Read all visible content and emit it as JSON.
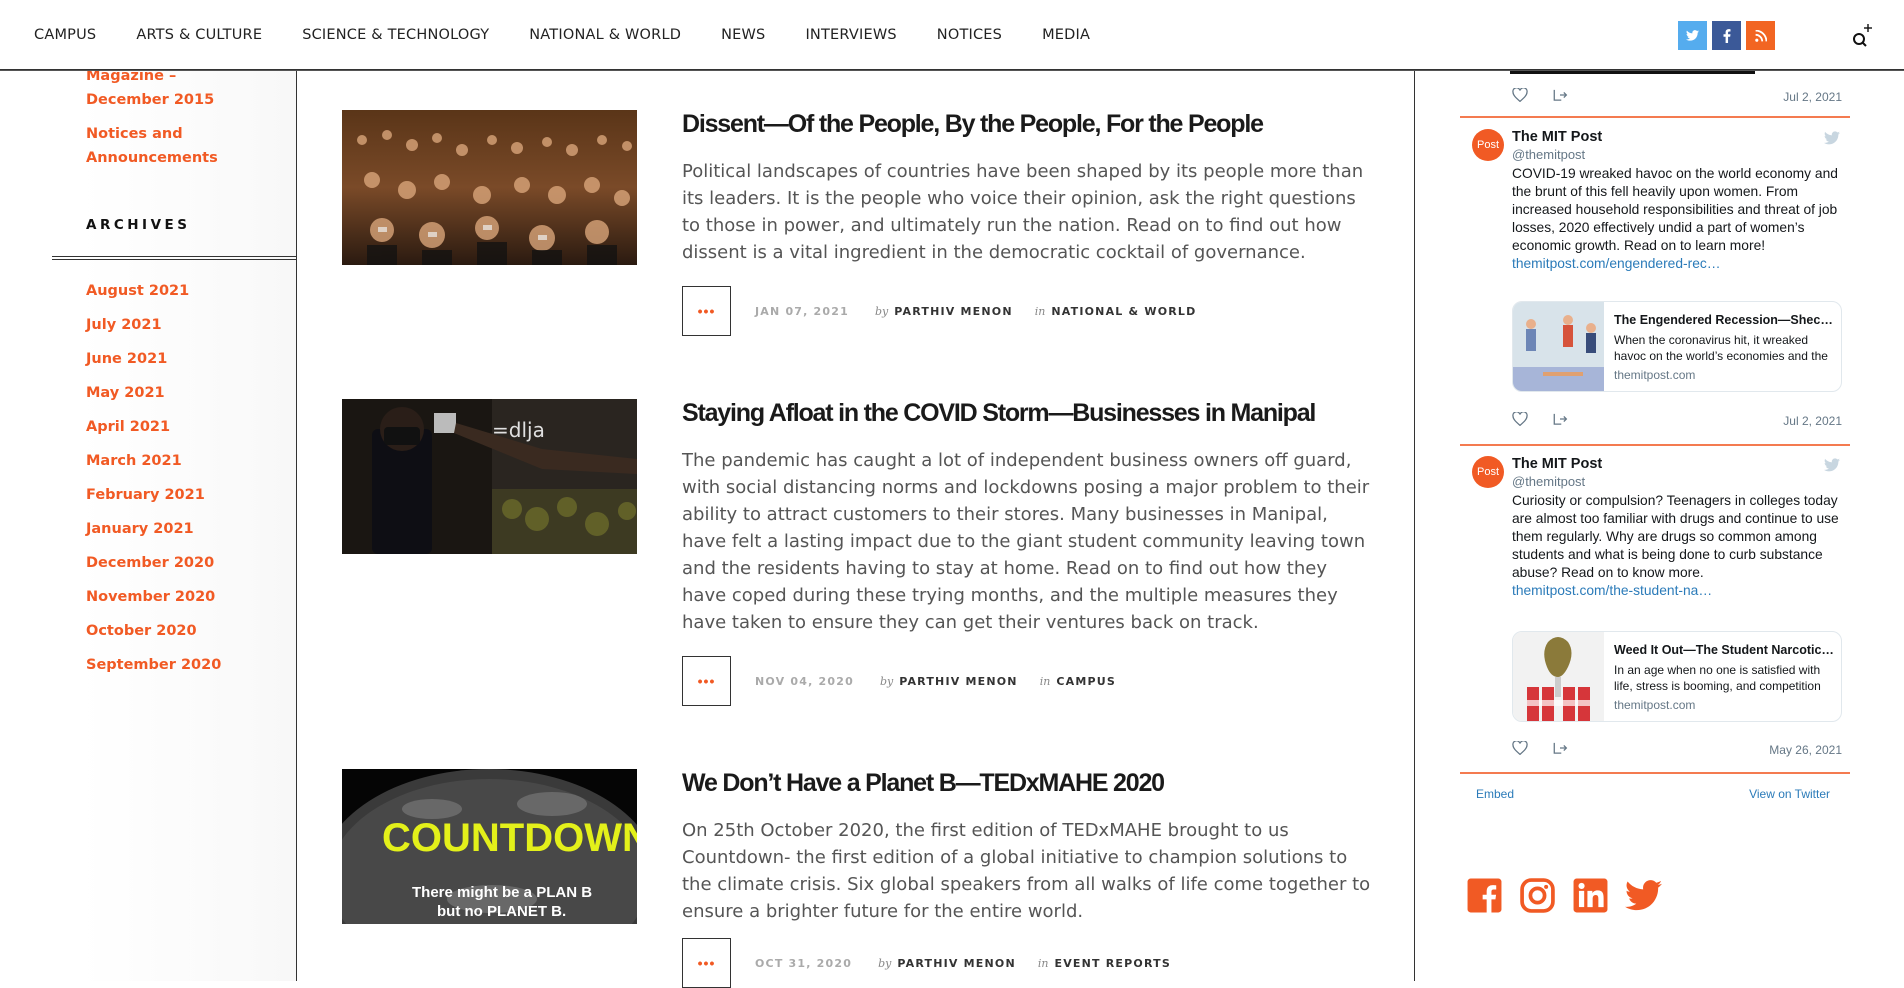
{
  "nav": {
    "items": [
      "CAMPUS",
      "ARTS & CULTURE",
      "SCIENCE & TECHNOLOGY",
      "NATIONAL & WORLD",
      "NEWS",
      "INTERVIEWS",
      "NOTICES",
      "MEDIA"
    ],
    "social": {
      "twitter": "t",
      "facebook": "f",
      "rss": "rss"
    },
    "search_icon": "search-icon"
  },
  "left_sidebar": {
    "link_magazine": "Magazine – December 2015",
    "link_notices": "Notices and Announcements",
    "archives_heading": "ARCHIVES",
    "archives": [
      "August 2021",
      "July 2021",
      "June 2021",
      "May 2021",
      "April 2021",
      "March 2021",
      "February 2021",
      "January 2021",
      "December 2020",
      "November 2020",
      "October 2020",
      "September 2020"
    ]
  },
  "articles": [
    {
      "title": "Dissent—Of the People, By the People, For the People",
      "excerpt": "Political landscapes of countries have been shaped by its people more than its leaders. It is the people who voice their opinion, ask the right questions to those in power, and ultimately run the nation. Read on to find out how dissent is a vital ingredient in the democratic cocktail of governance.",
      "more": "•••",
      "date": "JAN 07, 2021",
      "by": "by",
      "author": "PARTHIV MENON",
      "in": "in",
      "category": "NATIONAL & WORLD"
    },
    {
      "title": "Staying Afloat in the COVID Storm—Businesses in Manipal",
      "excerpt": "The pandemic has caught a lot of independent business owners off guard, with social distancing norms and lockdowns posing a major problem to their ability to attract customers to their stores. Many businesses in Manipal, have felt a lasting impact due to the giant student community leaving town and the residents having to stay at home. Read on to find out how they have coped during these trying months, and the multiple measures they have taken to ensure they can get their ventures back on track.",
      "more": "•••",
      "date": "NOV 04, 2020",
      "by": "by",
      "author": "PARTHIV MENON",
      "in": "in",
      "category": "CAMPUS"
    },
    {
      "title": "We Don’t Have a Planet B—TEDxMAHE 2020",
      "excerpt": "On 25th October 2020, the first edition of TEDxMAHE brought to us Countdown- the first edition of a global initiative to champion solutions to the climate crisis. Six global speakers from all walks of life come together to ensure a brighter future for the entire world.",
      "more": "•••",
      "date": "OCT 31, 2020",
      "by": "by",
      "author": "PARTHIV MENON",
      "in": "in",
      "category": "EVENT REPORTS",
      "thumb_text_1": "COUNTDOWN",
      "thumb_text_2": "There might be a PLAN B",
      "thumb_text_3": "but no PLANET B."
    }
  ],
  "twitter": {
    "first_date": "Jul 2, 2021",
    "tweets": [
      {
        "avatar": "Post",
        "name": "The MIT Post",
        "handle": "@themitpost",
        "text": "COVID-19 wreaked havoc on the world economy and the brunt of this fell heavily upon women. From increased household responsibilities and threat of job losses, 2020 effectively undid a part of women’s economic growth. Read on to learn more!",
        "link": "themitpost.com/engendered-rec…",
        "card_title": "The Engendered Recession—Shece…",
        "card_desc": "When the coronavirus hit, it wreaked havoc on the world’s economies and the",
        "card_domain": "themitpost.com",
        "date": "Jul 2, 2021"
      },
      {
        "avatar": "Post",
        "name": "The MIT Post",
        "handle": "@themitpost",
        "text": "Curiosity or compulsion? Teenagers in colleges today are almost too familiar with drugs and continue to use them regularly. Why are drugs so common among students and what is being done to curb substance abuse? Read on to know more.",
        "link": "themitpost.com/the-student-na…",
        "card_title": "Weed It Out—The Student Narcotic…",
        "card_desc": "In an age when no one is satisfied with life, stress is booming, and competition",
        "card_domain": "themitpost.com",
        "date": "May 26, 2021"
      }
    ],
    "embed": "Embed",
    "view_on_twitter": "View on Twitter"
  },
  "colors": {
    "accent": "#f15a24",
    "twitter_link": "#2b7bb9"
  }
}
